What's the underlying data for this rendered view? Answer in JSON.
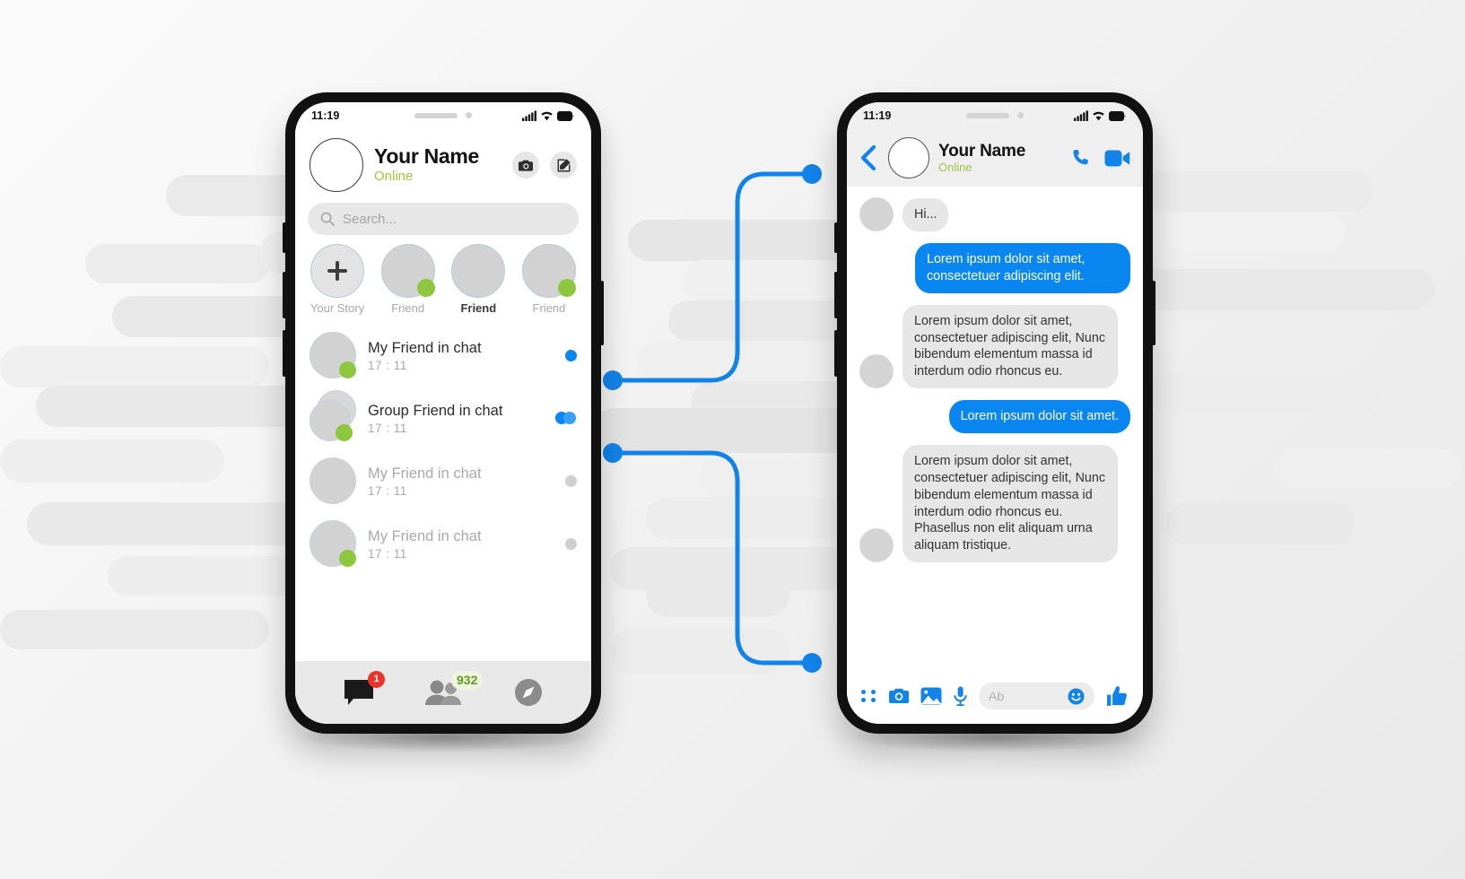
{
  "theme": {
    "accent_blue": "#0a86f0",
    "online_green": "#8dc63f",
    "badge_red": "#e8342a",
    "bubble_grey": "#e6e6e6"
  },
  "left_phone": {
    "status_bar": {
      "time": "11:19",
      "signal_icon": "signal-bars-icon",
      "wifi_icon": "wifi-icon",
      "battery_icon": "battery-icon"
    },
    "header": {
      "name": "Your Name",
      "status": "Online",
      "camera_button": "camera-icon",
      "compose_button": "compose-icon"
    },
    "search": {
      "placeholder": "Search...",
      "icon": "search-icon"
    },
    "stories": [
      {
        "label": "Your Story",
        "type": "add",
        "online": false,
        "highlight": false
      },
      {
        "label": "Friend",
        "type": "avatar",
        "online": true,
        "highlight": false
      },
      {
        "label": "Friend",
        "type": "avatar",
        "online": false,
        "highlight": true
      },
      {
        "label": "Friend",
        "type": "avatar",
        "online": true,
        "highlight": false
      }
    ],
    "chats": [
      {
        "name": "My Friend in chat",
        "time": "17 : 11",
        "unread": true,
        "online": true,
        "group": false,
        "mark": "blue-dot"
      },
      {
        "name": "Group Friend in chat",
        "time": "17 : 11",
        "unread": true,
        "online": true,
        "group": true,
        "mark": "blue-double-dot"
      },
      {
        "name": "My Friend in chat",
        "time": "17 : 11",
        "unread": false,
        "online": false,
        "group": false,
        "mark": "grey-dot"
      },
      {
        "name": "My Friend in chat",
        "time": "17 : 11",
        "unread": false,
        "online": true,
        "group": false,
        "mark": "grey-dot"
      }
    ],
    "bottom_nav": [
      {
        "icon": "chat-bubble-icon",
        "badge": "1",
        "badge_type": "red"
      },
      {
        "icon": "people-icon",
        "badge": "932",
        "badge_type": "green"
      },
      {
        "icon": "compass-icon",
        "badge": "",
        "badge_type": "none"
      }
    ]
  },
  "right_phone": {
    "status_bar": {
      "time": "11:19",
      "signal_icon": "signal-bars-icon",
      "wifi_icon": "wifi-icon",
      "battery_icon": "battery-icon"
    },
    "header": {
      "back_button": "back-chevron-icon",
      "name": "Your Name",
      "status": "Online",
      "call_button": "phone-call-icon",
      "video_button": "video-camera-icon"
    },
    "messages": [
      {
        "side": "in",
        "text": "Hi...",
        "avatar": true
      },
      {
        "side": "out",
        "text": "Lorem ipsum dolor sit amet, consectetuer adipiscing elit.",
        "avatar": false
      },
      {
        "side": "in",
        "text": "Lorem ipsum dolor sit amet, consectetuer adipiscing elit, Nunc bibendum elementum massa id interdum odio rhoncus eu.",
        "avatar": true
      },
      {
        "side": "out",
        "text": "Lorem ipsum dolor sit amet.",
        "avatar": false
      },
      {
        "side": "in",
        "text": "Lorem ipsum dolor sit amet, consectetuer adipiscing elit, Nunc bibendum elementum massa id interdum odio rhoncus eu. Phasellus non elit aliquam urna aliquam tristique.",
        "avatar": true
      }
    ],
    "input_bar": {
      "more_button": "four-dot-grid-icon",
      "camera_button": "camera-icon",
      "gallery_button": "image-icon",
      "mic_button": "microphone-icon",
      "text_placeholder": "Ab",
      "emoji_button": "smiley-icon",
      "like_button": "thumbs-up-icon"
    }
  }
}
